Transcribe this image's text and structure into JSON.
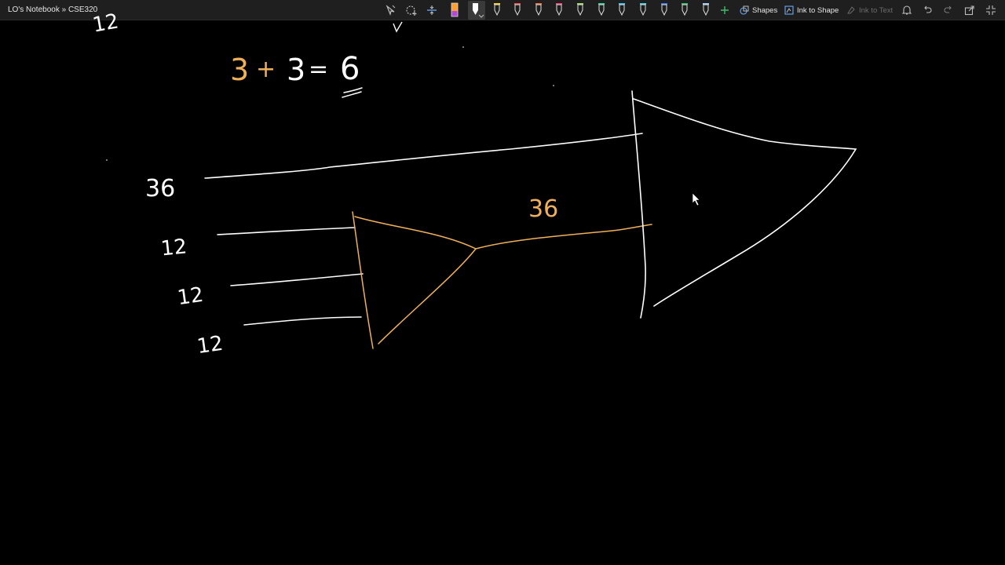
{
  "breadcrumb": "LO's Notebook » CSE320",
  "toolbar": {
    "shapes_label": "Shapes",
    "ink_to_shape_label": "Ink to Shape",
    "ink_to_text_label": "Ink to Text",
    "pen_colors": [
      "#ff9d2e",
      "#ffffff",
      "#ffd500",
      "#ff4a4a",
      "#ff6a3d",
      "#ff3b7a",
      "#9be15d",
      "#2bd99a",
      "#35c7f5",
      "#3fd7e8",
      "#3a7bff",
      "#2fc46a",
      "#9ad0ff"
    ],
    "accent_add": "#3fbf6a"
  },
  "ink": {
    "top_left_fragment": "12",
    "equation_lhs_a": "3",
    "equation_plus": "+",
    "equation_lhs_b": "3",
    "equation_eq": "=",
    "equation_result": "6",
    "input_wide": "36",
    "input_a": "12",
    "input_b": "12",
    "input_c": "12",
    "middle_output": "36"
  },
  "colors": {
    "ink_white": "#ffffff",
    "ink_orange": "#f0b05a"
  }
}
